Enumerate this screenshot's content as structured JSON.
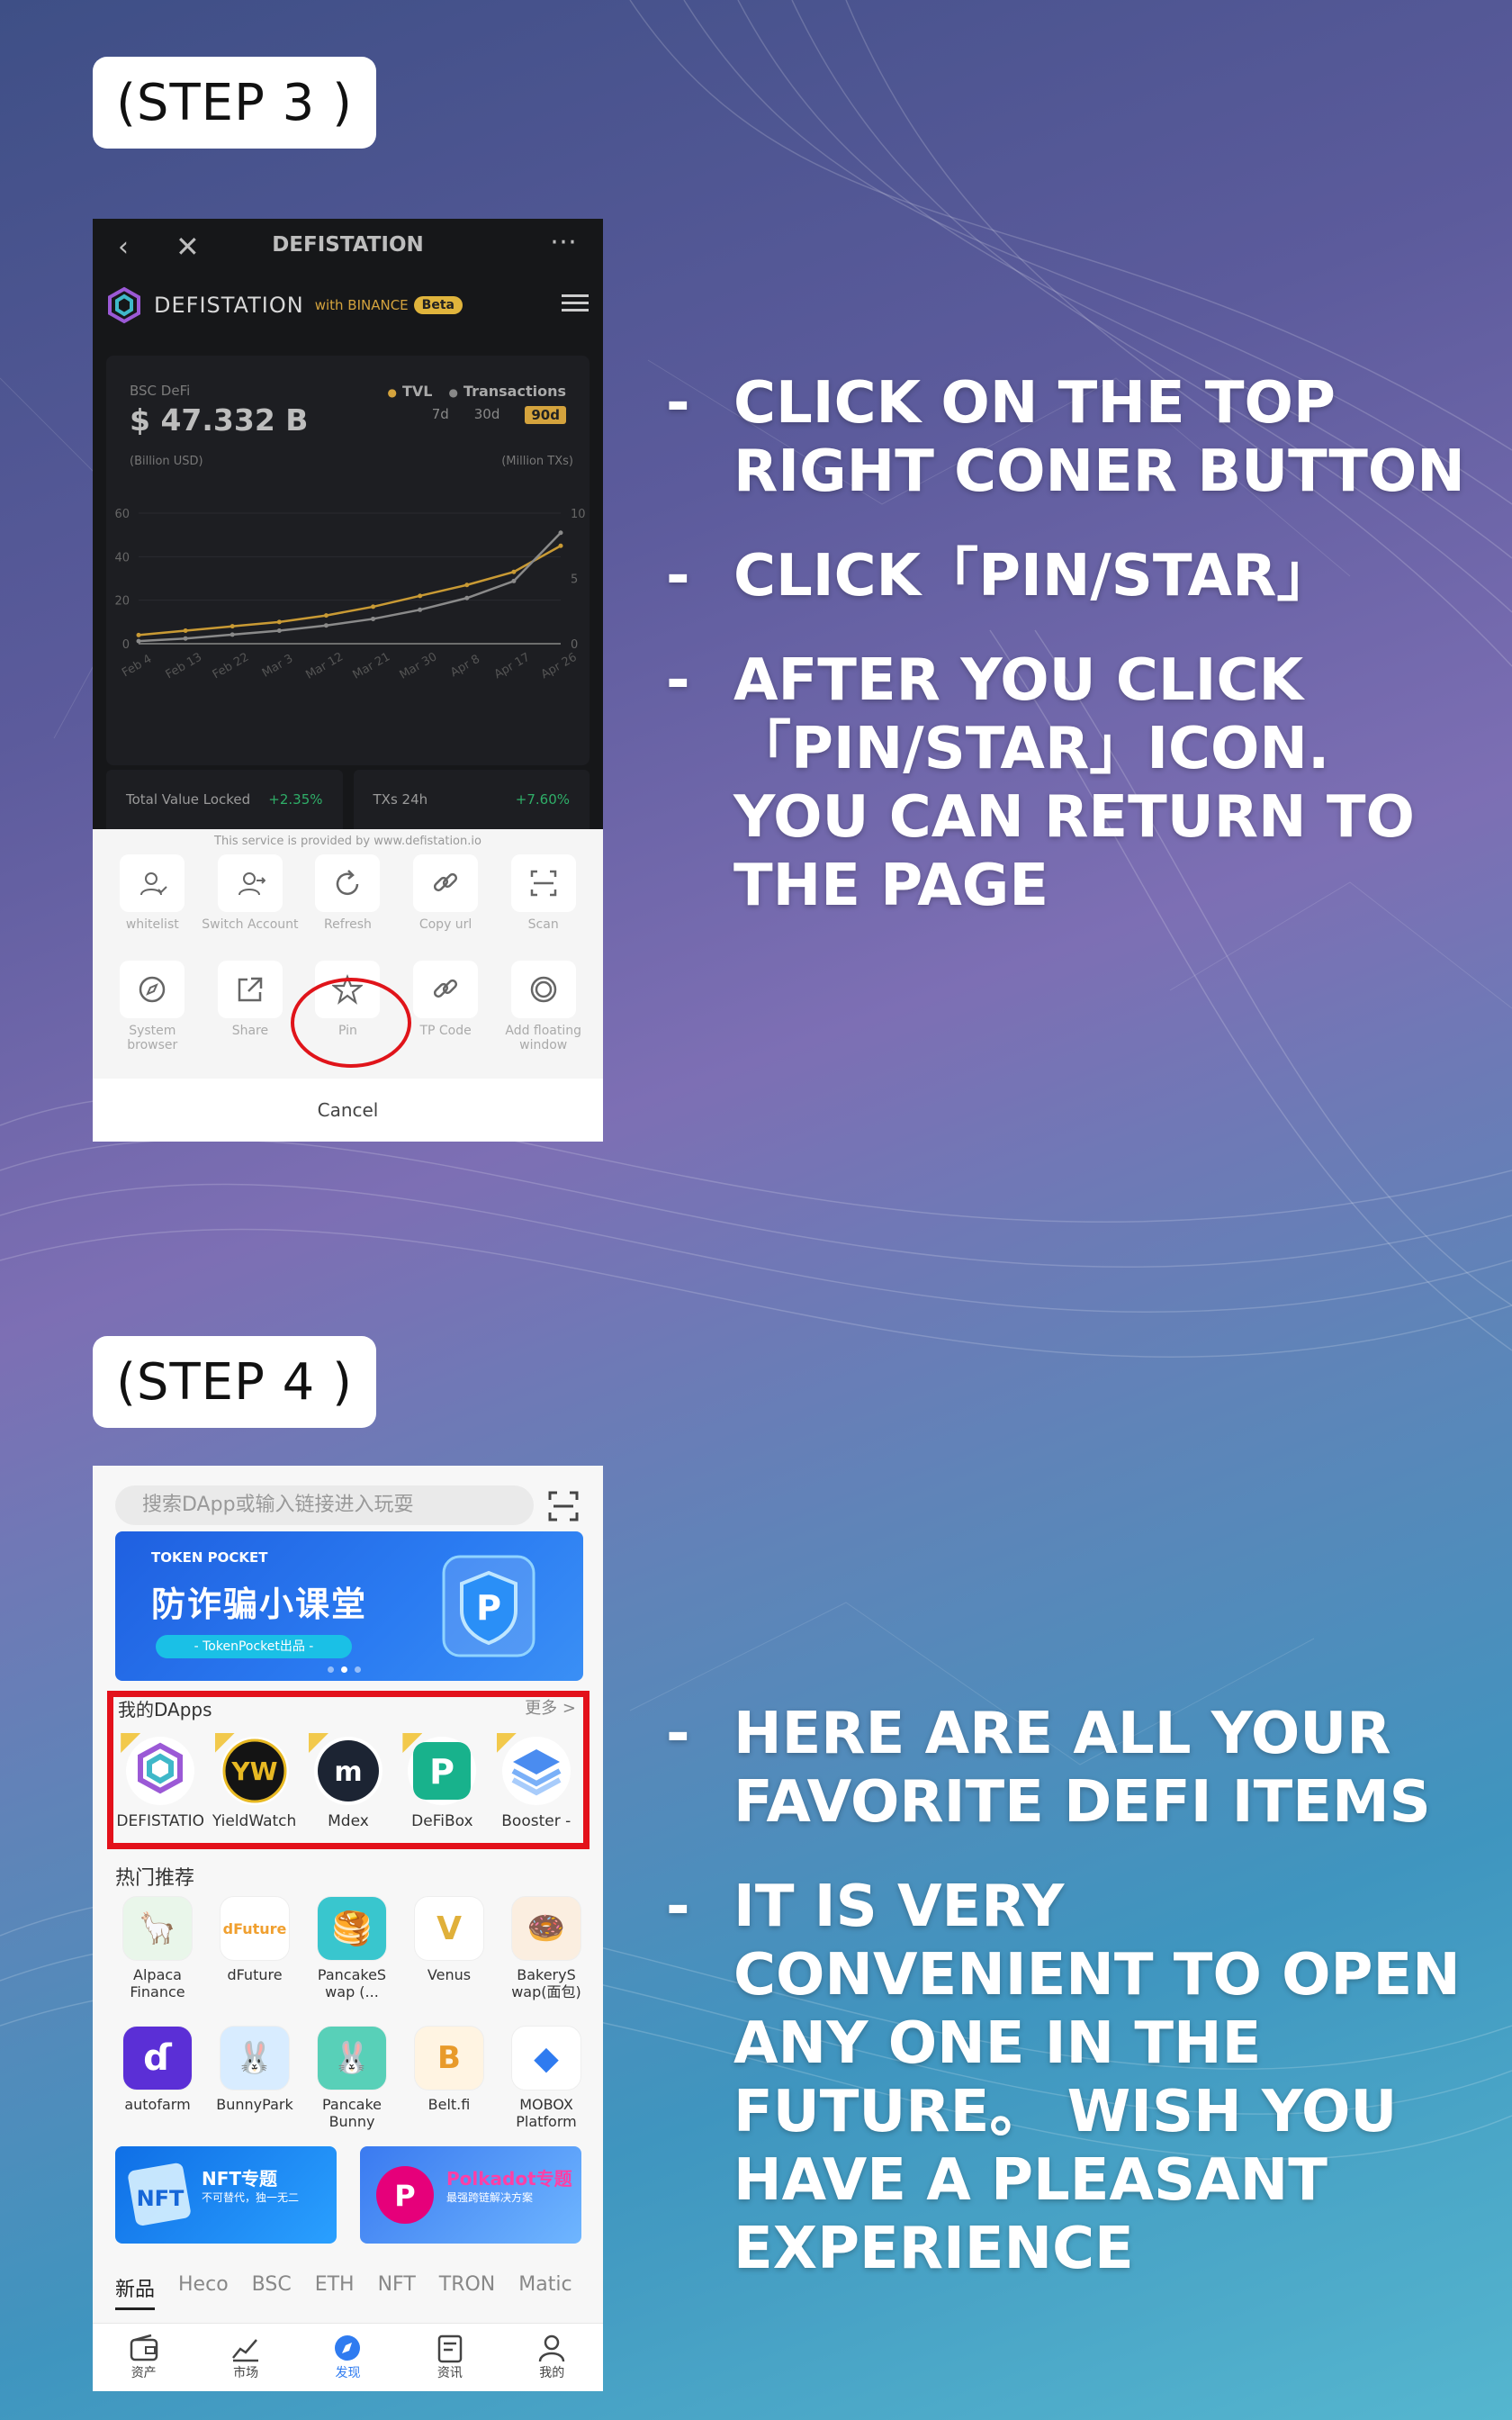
{
  "step3": {
    "label": "(STEP 3 )",
    "bullets": [
      "CLICK ON THE TOP RIGHT CONER BUTTON",
      "CLICK「PIN/STAR」",
      "AFTER YOU CLICK 「PIN/STAR」ICON. YOU CAN RETURN TO THE PAGE"
    ],
    "bullet_dash": "-",
    "phone": {
      "title": "DEFISTATION",
      "brand": "DEFISTATION",
      "with": "with BINANCE",
      "beta": "Beta",
      "chart": {
        "label": "BSC DeFi",
        "value": "$ 47.332 B",
        "legend_tvl": "TVL",
        "legend_tx": "Transactions",
        "periods": [
          "7d",
          "30d",
          "90d"
        ],
        "active_period": "90d",
        "left_unit": "(Billion USD)",
        "right_unit": "(Million TXs)"
      },
      "chart_data": {
        "type": "line",
        "x": [
          "Feb 4",
          "Feb 13",
          "Feb 22",
          "Mar 3",
          "Mar 12",
          "Mar 21",
          "Mar 30",
          "Apr 8",
          "Apr 17",
          "Apr 26"
        ],
        "series": [
          {
            "name": "TVL",
            "values": [
              4,
              6,
              8,
              10,
              13,
              17,
              22,
              27,
              33,
              45
            ]
          },
          {
            "name": "Transactions",
            "values": [
              0.2,
              0.4,
              0.7,
              1.0,
              1.4,
              1.9,
              2.6,
              3.5,
              4.8,
              8.5
            ]
          }
        ],
        "ylim_left": [
          0,
          60
        ],
        "yticks_left": [
          "60",
          "40",
          "20",
          "0"
        ],
        "ylim_right": [
          0,
          10
        ],
        "yticks_right": [
          "10",
          "5",
          "0"
        ],
        "colors": {
          "TVL": "#c99a34",
          "Transactions": "#8a8a8a"
        }
      },
      "stats": [
        {
          "label": "Total Value Locked",
          "change": "+2.35%"
        },
        {
          "label": "TXs 24h",
          "change": "+7.60%"
        }
      ],
      "sheet_note": "This service is provided by www.defistation.io",
      "actions": [
        {
          "label": "whitelist",
          "icon": "user-check-icon"
        },
        {
          "label": "Switch Account",
          "icon": "switch-user-icon"
        },
        {
          "label": "Refresh",
          "icon": "refresh-icon"
        },
        {
          "label": "Copy url",
          "icon": "link-icon"
        },
        {
          "label": "Scan",
          "icon": "scan-icon"
        },
        {
          "label": "System browser",
          "icon": "compass-icon"
        },
        {
          "label": "Share",
          "icon": "share-icon"
        },
        {
          "label": "Pin",
          "icon": "star-icon"
        },
        {
          "label": "TP Code",
          "icon": "link-icon"
        },
        {
          "label": "Add floating window",
          "icon": "floating-window-icon"
        }
      ],
      "cancel": "Cancel"
    }
  },
  "step4": {
    "label": "(STEP 4 )",
    "bullets": [
      "HERE ARE ALL YOUR FAVORITE DEFI ITEMS",
      "IT IS VERY CONVENIENT TO OPEN ANY ONE IN THE FUTURE。 WISH YOU HAVE A PLEASANT EXPERIENCE"
    ],
    "bullet_dash": "-",
    "phone": {
      "search_placeholder": "搜索DApp或输入链接进入玩耍",
      "banner_brand": "TOKEN POCKET",
      "banner_title": "防诈骗小课堂",
      "banner_pill": "- TokenPocket出品 -",
      "my_dapps_title": "我的DApps",
      "my_dapps_more": "更多 >",
      "my_dapps": [
        {
          "label": "DEFISTATIO",
          "color": "#ffffff"
        },
        {
          "label": "YieldWatch",
          "color": "#1a1a1a"
        },
        {
          "label": "Mdex",
          "color": "#1c2433"
        },
        {
          "label": "DeFiBox",
          "color": "#18b28c"
        },
        {
          "label": "Booster -",
          "color": "#4a8cf0"
        }
      ],
      "hot_title": "热门推荐",
      "hot": [
        {
          "label": "Alpaca Finance",
          "color": "#e9f6ea"
        },
        {
          "label": "dFuture",
          "color": "#ffffff"
        },
        {
          "label": "PancakeS wap (...",
          "color": "#39c6ce"
        },
        {
          "label": "Venus",
          "color": "#ffffff"
        },
        {
          "label": "BakeryS wap(面包)",
          "color": "#fbeee0"
        },
        {
          "label": "autofarm",
          "color": "#5b2fd6"
        },
        {
          "label": "BunnyPark",
          "color": "#d8ecff"
        },
        {
          "label": "Pancake Bunny",
          "color": "#58d0b8"
        },
        {
          "label": "Belt.fi",
          "color": "#fff4e2"
        },
        {
          "label": "MOBOX Platform",
          "color": "#ffffff"
        }
      ],
      "promos": [
        {
          "title": "NFT专题",
          "sub": "不可替代，独一无二",
          "color": "#1a7ff0"
        },
        {
          "title": "Polkadot专题",
          "sub": "最强跨链解决方案",
          "color": "#4a8af0"
        }
      ],
      "tabs": [
        "新品",
        "Heco",
        "BSC",
        "ETH",
        "NFT",
        "TRON",
        "Matic"
      ],
      "active_tab": "新品",
      "nav": [
        "资产",
        "市场",
        "发现",
        "资讯",
        "我的"
      ],
      "active_nav": "发现"
    }
  }
}
